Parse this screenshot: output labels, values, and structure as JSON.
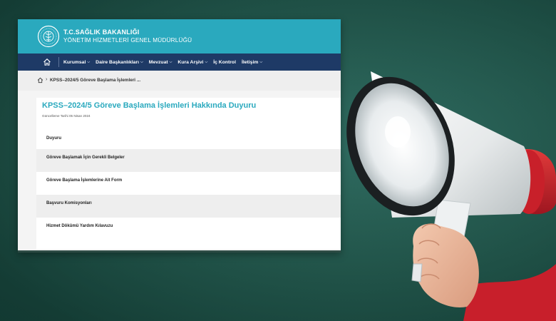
{
  "header": {
    "ministry": "T.C.SAĞLIK BAKANLIĞI",
    "department": "YÖNETİM HİZMETLERİ GENEL MÜDÜRLÜĞÜ"
  },
  "nav": {
    "home_icon": "home-icon",
    "items": [
      {
        "label": "Kurumsal",
        "has_dropdown": true
      },
      {
        "label": "Daire Başkanlıkları",
        "has_dropdown": true
      },
      {
        "label": "Mevzuat",
        "has_dropdown": true
      },
      {
        "label": "Kura Arşivi",
        "has_dropdown": true
      },
      {
        "label": "İç Kontrol",
        "has_dropdown": false
      },
      {
        "label": "İletişim",
        "has_dropdown": true
      }
    ],
    "chevron": "⌵"
  },
  "breadcrumb": {
    "separator": "›",
    "current": "KPSS–2024/5 Göreve Başlama İşlemleri ..."
  },
  "page": {
    "title": "KPSS–2024/5 Göreve Başlama İşlemleri Hakkında Duyuru",
    "updated": "Güncelleme Tarihi 05 Nisan 2024"
  },
  "list": {
    "items": [
      "Duyuru",
      "Göreve Başlamak İçin Gerekli Belgeler",
      "Göreve Başlama İşlemlerine Ait Form",
      "Başvuru Komisyonları",
      "Hizmet Dökümü Yardım Kılavuzu"
    ]
  },
  "colors": {
    "header_teal": "#2aa9be",
    "nav_navy": "#1e3a66",
    "title_teal": "#2aa9be",
    "background_green": "#215449",
    "megaphone_red": "#c8202a"
  }
}
